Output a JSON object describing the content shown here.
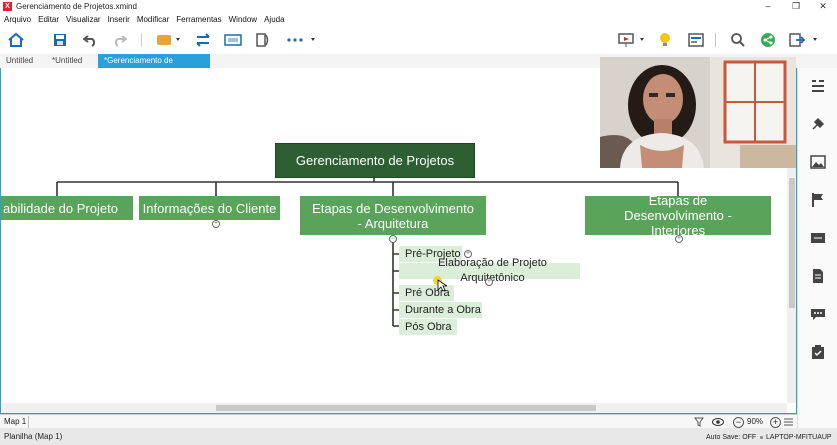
{
  "window": {
    "title": "Gerenciamento de Projetos.xmind",
    "app_icon": "X"
  },
  "menu": [
    "Arquivo",
    "Editar",
    "Visualizar",
    "Inserir",
    "Modificar",
    "Ferramentas",
    "Window",
    "Ajuda"
  ],
  "tabs": [
    "Untitled",
    "*Untitled",
    "*Gerenciamento de Projetos"
  ],
  "tab_close": "✕",
  "mindmap": {
    "central": "Gerenciamento de Projetos",
    "main": [
      "abilidade do Projeto",
      "Informações do Cliente",
      "Etapas de Desenvolvimento - Arquitetura",
      "Etapas de Desenvolvimento - Interiores"
    ],
    "subtopics": [
      "Pré-Projeto",
      "Elaboração de Projeto Arquitetônico",
      "Pré Obra",
      "Durante a Obra",
      "Pós Obra"
    ]
  },
  "status": {
    "sheet": "Map 1",
    "zoom": "90%"
  },
  "footer": {
    "left": "Planilha (Map 1)",
    "autosave": "Auto Save: OFF",
    "computer": "LAPTOP-MFITUAUP"
  },
  "colors": {
    "accent": "#2aa0d8",
    "central": "#2d5f32",
    "main": "#5aa35a",
    "sub": "#dbeed9"
  }
}
